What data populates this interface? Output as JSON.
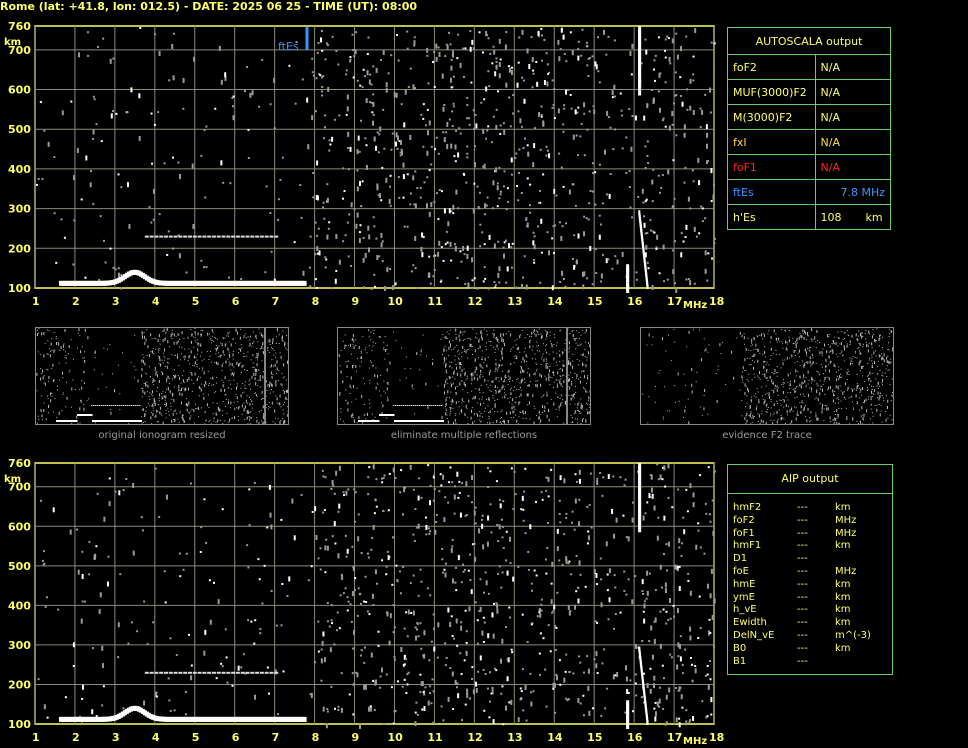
{
  "header": {
    "title": "Rome (lat: +41.8, lon: 012.5) - DATE: 2025 06 25 - TIME (UT): 08:00"
  },
  "plot": {
    "y_unit": "km",
    "x_unit": "MHz",
    "y_ticks": [
      "760",
      "700",
      "600",
      "500",
      "400",
      "300",
      "200",
      "100"
    ],
    "x_ticks": [
      "1",
      "2",
      "3",
      "4",
      "5",
      "6",
      "7",
      "8",
      "9",
      "10",
      "11",
      "12",
      "13",
      "14",
      "15",
      "16",
      "17",
      "18"
    ],
    "ftEs_marker": "ftEs"
  },
  "autoscala": {
    "title": "AUTOSCALA output",
    "rows": [
      {
        "label": "foF2",
        "value": "N/A",
        "label_color": "#ffff66",
        "value_color": "#ffff66"
      },
      {
        "label": "MUF(3000)F2",
        "value": "N/A",
        "label_color": "#ffff66",
        "value_color": "#ffff66"
      },
      {
        "label": "M(3000)F2",
        "value": "N/A",
        "label_color": "#ffff66",
        "value_color": "#ffff66"
      },
      {
        "label": "fxI",
        "value": "N/A",
        "label_color": "#ffdd33",
        "value_color": "#ffdd33"
      },
      {
        "label": "foF1",
        "value": "N/A",
        "label_color": "#ff2222",
        "value_color": "#ff2222"
      },
      {
        "label": "ftEs",
        "value": "7.8 MHz",
        "label_color": "#3399ff",
        "value_color": "#3399ff"
      },
      {
        "label": "h'Es",
        "value": "108",
        "unit": "km",
        "label_color": "#ffff66",
        "value_color": "#ffff66"
      }
    ]
  },
  "thumbnails": [
    {
      "caption": "original ionogram resized"
    },
    {
      "caption": "eliminate multiple reflections"
    },
    {
      "caption": "evidence F2 trace"
    }
  ],
  "aip": {
    "title": "AIP output",
    "rows": [
      {
        "name": "hmF2",
        "value": "---",
        "unit": "km"
      },
      {
        "name": "foF2",
        "value": "---",
        "unit": "MHz"
      },
      {
        "name": "foF1",
        "value": "---",
        "unit": "MHz"
      },
      {
        "name": "hmF1",
        "value": "---",
        "unit": "km"
      },
      {
        "name": "D1",
        "value": "---",
        "unit": ""
      },
      {
        "name": "foE",
        "value": "---",
        "unit": "MHz"
      },
      {
        "name": "hmE",
        "value": "---",
        "unit": "km"
      },
      {
        "name": "ymE",
        "value": "---",
        "unit": "km"
      },
      {
        "name": "h_vE",
        "value": "---",
        "unit": "km"
      },
      {
        "name": "Ewidth",
        "value": "---",
        "unit": "km"
      },
      {
        "name": "DelN_vE",
        "value": "---",
        "unit": "m^(-3)"
      },
      {
        "name": "B0",
        "value": "---",
        "unit": "km"
      },
      {
        "name": "B1",
        "value": "---",
        "unit": ""
      }
    ]
  },
  "colors": {
    "grid": "#8a8a7a",
    "axis": "#ffff66",
    "border_green": "#66cc66",
    "es_blue": "#3399ff"
  }
}
